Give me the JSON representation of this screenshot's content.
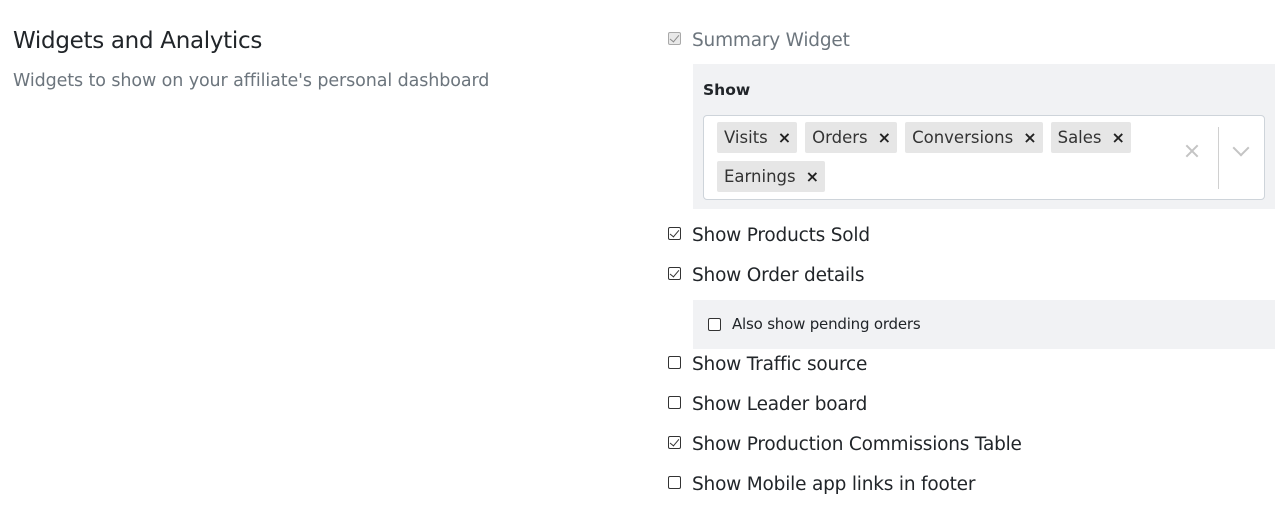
{
  "section": {
    "title": "Widgets and Analytics",
    "description": "Widgets to show on your affiliate's personal dashboard"
  },
  "summary_widget": {
    "label": "Summary Widget",
    "checked": true,
    "disabled": true
  },
  "show_select": {
    "label": "Show",
    "tags": [
      "Visits",
      "Orders",
      "Conversions",
      "Sales",
      "Earnings"
    ],
    "clear_icon": "close-icon",
    "dropdown_icon": "chevron-down-icon"
  },
  "options": {
    "products_sold": {
      "label": "Show Products Sold",
      "checked": true
    },
    "order_details": {
      "label": "Show Order details",
      "checked": true
    },
    "pending_orders": {
      "label": "Also show pending orders",
      "checked": false
    },
    "traffic_source": {
      "label": "Show Traffic source",
      "checked": false
    },
    "leader_board": {
      "label": "Show Leader board",
      "checked": false
    },
    "commissions_table": {
      "label": "Show Production Commissions Table",
      "checked": true
    },
    "mobile_links": {
      "label": "Show Mobile app links in footer",
      "checked": false
    }
  }
}
